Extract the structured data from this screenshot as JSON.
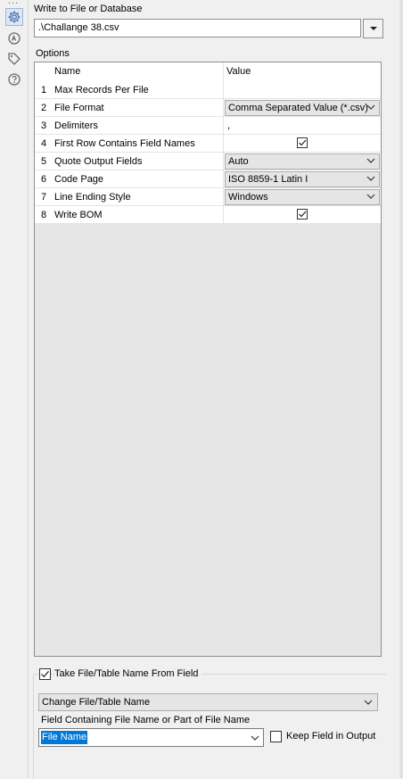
{
  "sidebar": {
    "more": "...",
    "icons": [
      "settings-gear-icon",
      "annotation-icon",
      "tag-icon",
      "help-icon"
    ]
  },
  "destination": {
    "label": "Write to File or Database",
    "value": ".\\Challange 38.csv"
  },
  "options": {
    "label": "Options",
    "col_name": "Name",
    "col_value": "Value",
    "rows": [
      {
        "num": "1",
        "name": "Max Records Per File",
        "value": ""
      },
      {
        "num": "2",
        "name": "File Format",
        "value": "Comma Separated Value (*.csv)"
      },
      {
        "num": "3",
        "name": "Delimiters",
        "value": ","
      },
      {
        "num": "4",
        "name": "First Row Contains Field Names",
        "checked": true
      },
      {
        "num": "5",
        "name": "Quote Output Fields",
        "value": "Auto"
      },
      {
        "num": "6",
        "name": "Code Page",
        "value": "ISO 8859-1 Latin I"
      },
      {
        "num": "7",
        "name": "Line Ending Style",
        "value": "Windows"
      },
      {
        "num": "8",
        "name": "Write BOM",
        "checked": true
      }
    ]
  },
  "take_from_field": {
    "label": "Take File/Table Name From Field",
    "checked": true,
    "mode": "Change File/Table Name",
    "field_label": "Field Containing File Name or Part of File Name",
    "field_value": "File Name",
    "keep_label": "Keep Field in Output",
    "keep_checked": false
  },
  "colors": {
    "selection": "#0078d7",
    "panel": "#f0f0f0"
  }
}
